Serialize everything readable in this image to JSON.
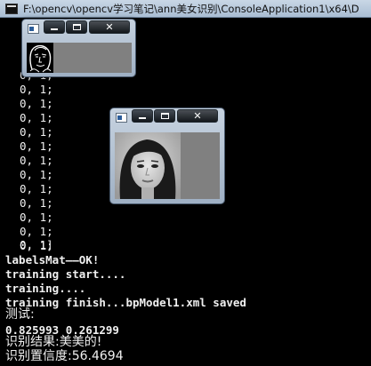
{
  "console": {
    "title": "F:\\opencv\\opencv学习笔记\\ann美女识别\\ConsoleApplication1\\x64\\D",
    "lines": [
      "0, 1;",
      "0, 1;",
      "0, 1;",
      "0, 1;",
      "0, 1;",
      "0, 1;",
      "0, 1;",
      "0, 1;",
      "0, 1;",
      "0, 1;",
      "0, 1;",
      "0, 1;",
      "0, 1;",
      "0, 1]",
      "labelsMat——OK!",
      "training start....",
      "training....",
      "training finish...bpModel1.xml saved",
      "测试:",
      "0.825993 0.261299",
      "识别结果:美美的!",
      "识别置信度:56.4694"
    ]
  },
  "window_small": {
    "minimize_label": "",
    "maximize_label": "",
    "close_label": "✕",
    "image": "sketch-face-image"
  },
  "window_photo": {
    "close_label": "✕",
    "image": "portrait-photo"
  }
}
